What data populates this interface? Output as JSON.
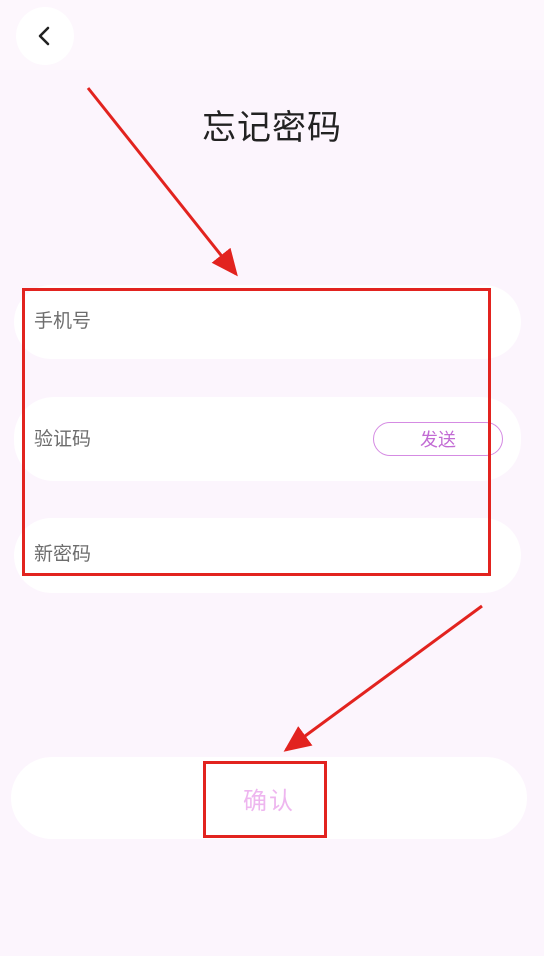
{
  "header": {
    "back_icon": "chevron-left-icon",
    "title": "忘记密码"
  },
  "form": {
    "phone_placeholder": "手机号",
    "code_placeholder": "验证码",
    "send_label": "发送",
    "new_password_placeholder": "新密码"
  },
  "confirm_label": "确认",
  "colors": {
    "background": "#fcf5fd",
    "accent": "#c26bd4",
    "confirm_text": "#eeb6ef",
    "annotation": "#e2231f"
  }
}
